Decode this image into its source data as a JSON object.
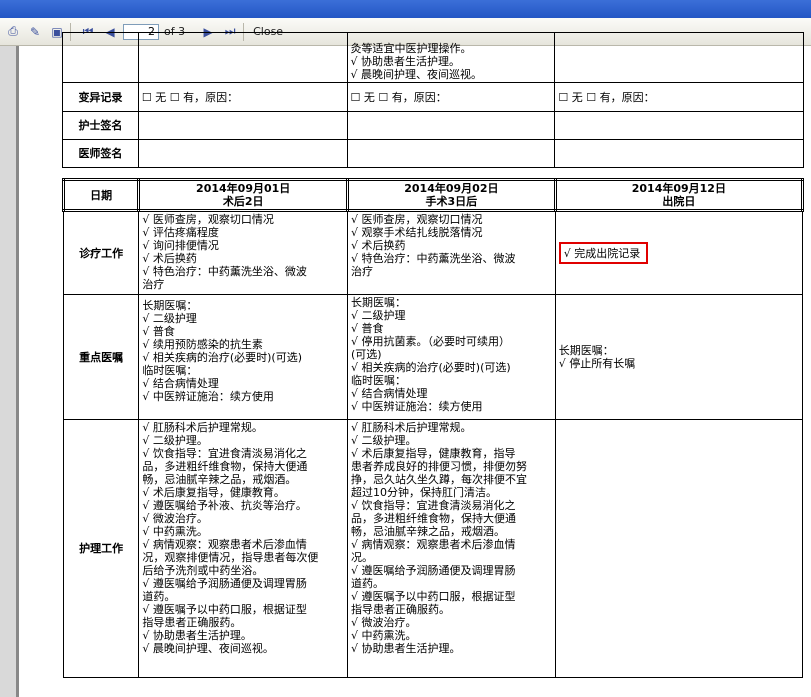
{
  "toolbar": {
    "page_value": "2",
    "page_total": "of 3",
    "close_label": "Close"
  },
  "top_table": {
    "cont_col1": "灸等适宜中医护理操作。",
    "cont_col2": "√ 协助患者生活护理。",
    "cont_col3": "√ 晨晚间护理、夜间巡视。",
    "variance_label": "变异记录",
    "variance_text": "☐ 无 ☐ 有，原因：",
    "nurse_label": "护士签名",
    "doctor_label": "医师签名"
  },
  "main_table": {
    "date_label": "日期",
    "columns": [
      {
        "date": "2014年09月01日",
        "stage": "术后2日"
      },
      {
        "date": "2014年09月02日",
        "stage": "手术3日后"
      },
      {
        "date": "2014年09月12日",
        "stage": "出院日"
      }
    ],
    "rows": {
      "diagnosis": {
        "label": "诊疗工作",
        "col1": [
          "√ 医师查房，观察切口情况",
          "√ 评估疼痛程度",
          "√ 询问排便情况",
          "√ 术后换药",
          "√ 特色治疗：中药薰洗坐浴、微波",
          "治疗"
        ],
        "col2": [
          "√ 医师查房，观察切口情况",
          "√ 观察手术结扎线脱落情况",
          "√ 术后换药",
          "√ 特色治疗：中药薰洗坐浴、微波",
          "治疗"
        ],
        "col3": "√ 完成出院记录"
      },
      "orders": {
        "label": "重点医嘱",
        "col1": [
          "长期医嘱：",
          "√ 二级护理",
          "√ 普食",
          "√ 续用预防感染的抗生素",
          "√ 相关疾病的治疗(必要时)(可选)",
          "临时医嘱：",
          "√ 结合病情处理",
          "√ 中医辨证施治：续方使用"
        ],
        "col2": [
          "长期医嘱：",
          "√ 二级护理",
          "√ 普食",
          "√ 停用抗菌素。（必要时可续用）",
          "(可选)",
          "√ 相关疾病的治疗(必要时)(可选)",
          "临时医嘱：",
          "√ 结合病情处理",
          "√ 中医辨证施治：续方使用"
        ],
        "col3": [
          "长期医嘱：",
          "√ 停止所有长嘱"
        ]
      },
      "nursing": {
        "label": "护理工作",
        "col1": [
          "√ 肛肠科术后护理常规。",
          "√ 二级护理。",
          "√ 饮食指导：宜进食清淡易消化之",
          "品，多进粗纤维食物，保持大便通",
          "畅，忌油腻辛辣之品，戒烟酒。",
          "√ 术后康复指导，健康教育。",
          "√ 遵医嘱给予补液、抗炎等治疗。",
          "√ 微波治疗。",
          "√ 中药熏洗。",
          "√ 病情观察：观察患者术后渗血情",
          "况，观察排便情况，指导患者每次便",
          "后给予洗剂或中药坐浴。",
          "√ 遵医嘱给予润肠通便及调理胃肠",
          "道药。",
          "√ 遵医嘱予以中药口服，根据证型",
          "指导患者正确服药。",
          "√ 协助患者生活护理。",
          "√ 晨晚间护理、夜间巡视。"
        ],
        "col2": [
          "√ 肛肠科术后护理常规。",
          "√ 二级护理。",
          "√ 术后康复指导，健康教育，指导",
          "患者养成良好的排便习惯，排便勿努",
          "挣，忌久站久坐久蹲，每次排便不宜",
          "超过10分钟，保持肛门清洁。",
          "√ 饮食指导：宜进食清淡易消化之",
          "品，多进粗纤维食物，保持大便通",
          "畅，忌油腻辛辣之品，戒烟酒。",
          "√ 病情观察：观察患者术后渗血情",
          "况。",
          "√ 遵医嘱给予润肠通便及调理胃肠",
          "道药。",
          "√ 遵医嘱予以中药口服，根据证型",
          "指导患者正确服药。",
          "√ 微波治疗。",
          "√ 中药熏洗。",
          "√ 协助患者生活护理。"
        ]
      }
    }
  }
}
